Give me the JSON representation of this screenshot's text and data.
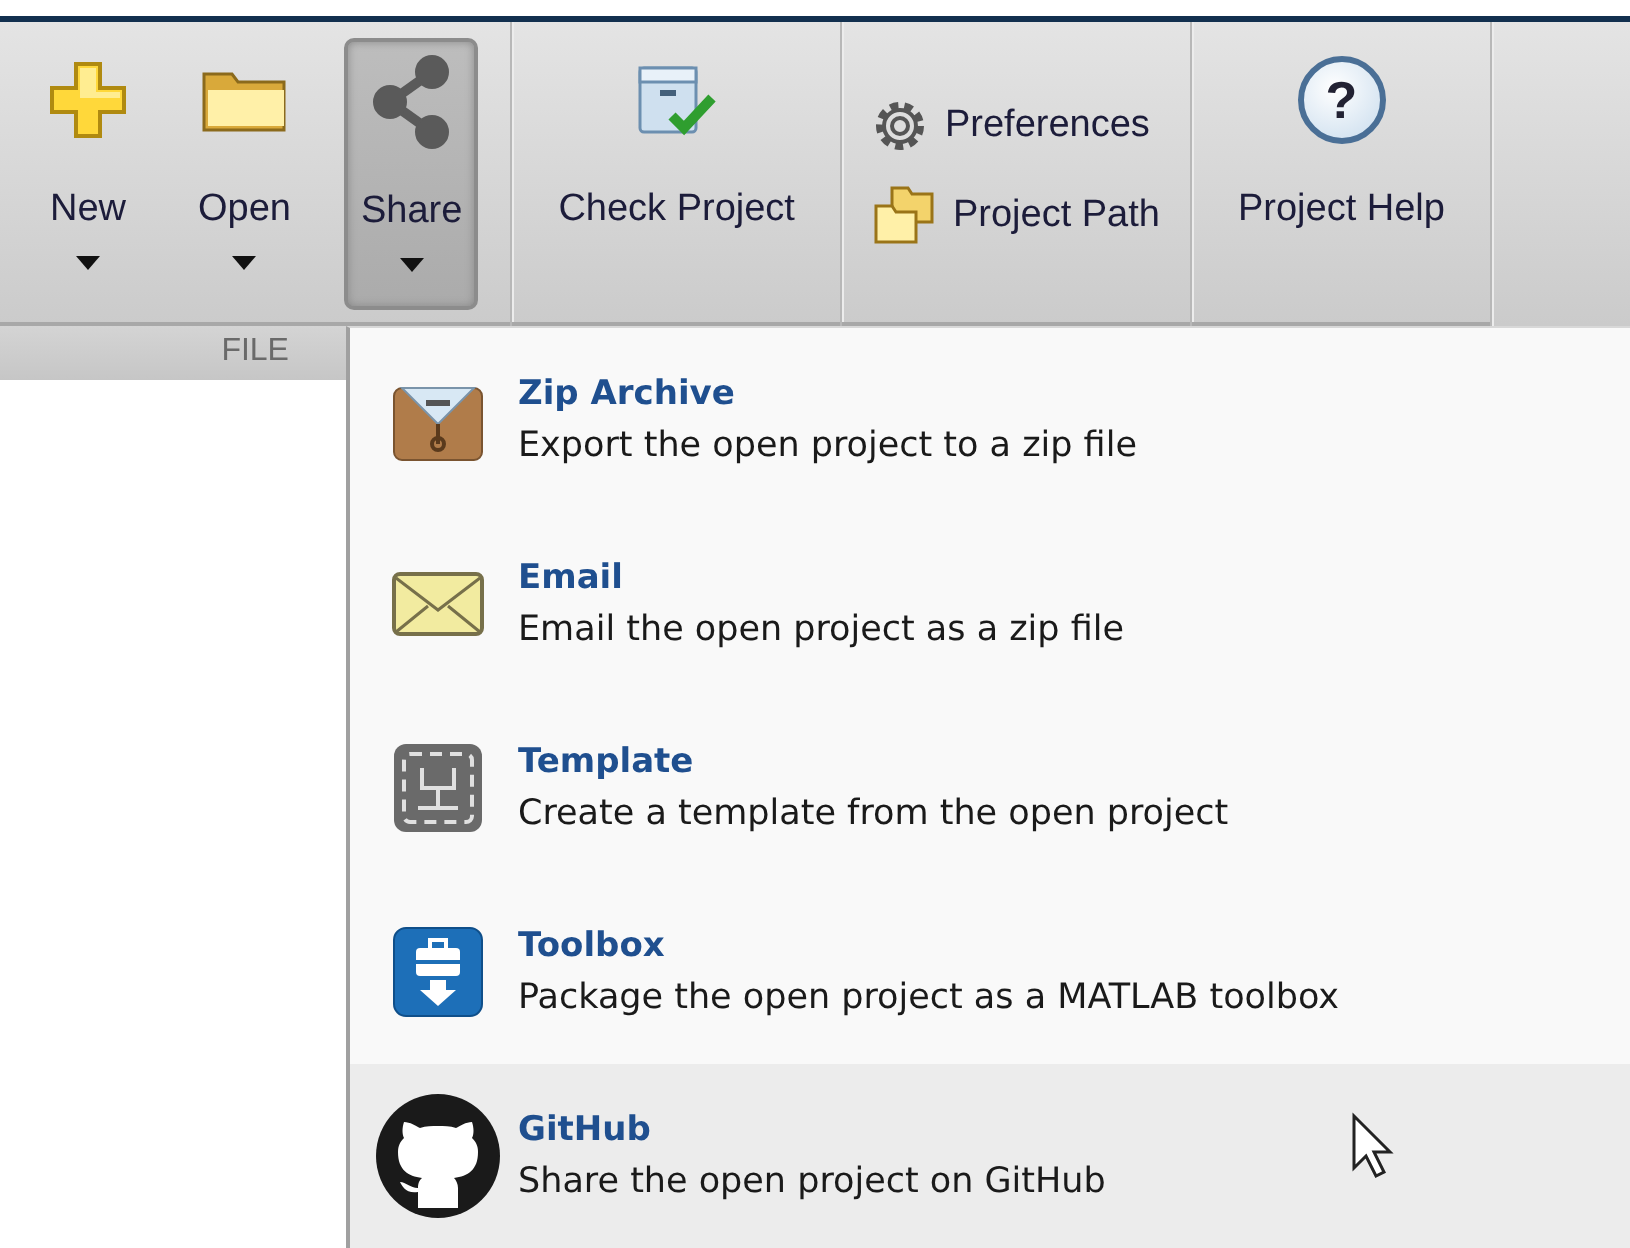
{
  "toolstrip": {
    "sections": [
      {
        "label": "FILE",
        "kind": "large",
        "buttons": [
          {
            "kind": "new",
            "label": "New",
            "dropdown": true,
            "selected": false
          },
          {
            "kind": "open",
            "label": "Open",
            "dropdown": true,
            "selected": false
          },
          {
            "kind": "share",
            "label": "Share",
            "dropdown": true,
            "selected": true
          }
        ]
      },
      {
        "kind": "large",
        "buttons": [
          {
            "kind": "check",
            "label": "Check Project",
            "dropdown": false,
            "selected": false
          }
        ]
      },
      {
        "kind": "small",
        "buttons": [
          {
            "kind": "preferences",
            "label": "Preferences",
            "dropdown": false,
            "selected": false
          },
          {
            "kind": "path",
            "label": "Project Path",
            "dropdown": false,
            "selected": false
          }
        ]
      },
      {
        "kind": "large",
        "buttons": [
          {
            "kind": "help",
            "label": "Project Help",
            "glyph": "?",
            "dropdown": false,
            "selected": false
          }
        ]
      }
    ]
  },
  "menu": {
    "items": [
      {
        "kind": "zip",
        "title": "Zip Archive",
        "description": "Export the open project to a zip file",
        "selected": false
      },
      {
        "kind": "email",
        "title": "Email",
        "description": "Email the open project as a zip file",
        "selected": false
      },
      {
        "kind": "template",
        "title": "Template",
        "description": "Create a template from the open project",
        "selected": false
      },
      {
        "kind": "toolbox",
        "title": "Toolbox",
        "description": "Package the open project as a MATLAB toolbox",
        "selected": false
      },
      {
        "kind": "github",
        "title": "GitHub",
        "description": "Share the open project on GitHub",
        "selected": true
      }
    ]
  }
}
